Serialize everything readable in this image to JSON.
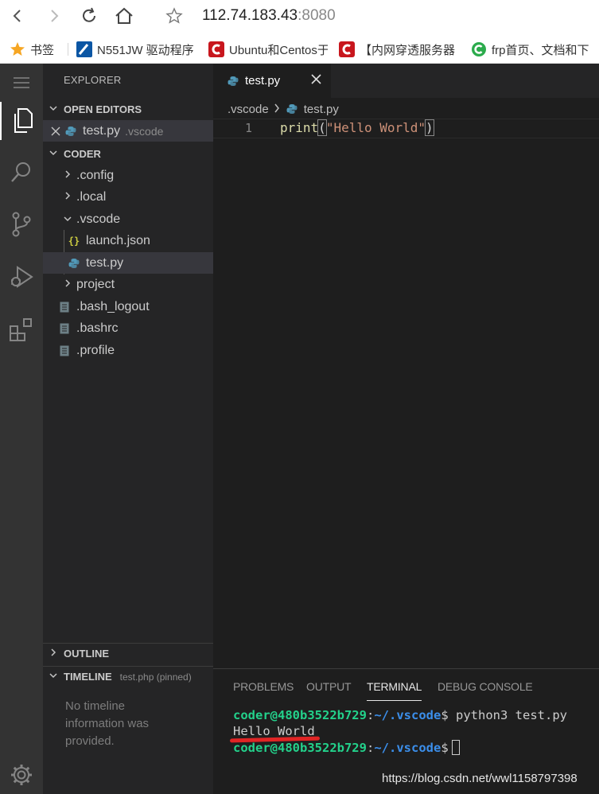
{
  "browser": {
    "url_host": "112.74.183.43",
    "url_port": ":8080"
  },
  "bookmarks": [
    {
      "label": "书签"
    },
    {
      "label": "N551JW 驱动程序"
    },
    {
      "label": "Ubuntu和Centos于"
    },
    {
      "label": "【内网穿透服务器"
    },
    {
      "label": "frp首页、文档和下"
    }
  ],
  "sidebar": {
    "title": "EXPLORER",
    "open_editors_label": "OPEN EDITORS",
    "open_editor": {
      "name": "test.py",
      "dir": ".vscode"
    },
    "workspace_label": "CODER",
    "tree": [
      {
        "label": ".config"
      },
      {
        "label": ".local"
      },
      {
        "label": ".vscode"
      },
      {
        "label": "launch.json"
      },
      {
        "label": "test.py"
      },
      {
        "label": "project"
      },
      {
        "label": ".bash_logout"
      },
      {
        "label": ".bashrc"
      },
      {
        "label": ".profile"
      }
    ],
    "outline_label": "OUTLINE",
    "timeline_label": "TIMELINE",
    "timeline_file": "test.php (pinned)",
    "timeline_empty": "No timeline information was provided."
  },
  "editor": {
    "tab_label": "test.py",
    "breadcrumb": {
      "folder": ".vscode",
      "file": "test.py"
    },
    "line_number": "1",
    "code": {
      "fn": "print",
      "open": "(",
      "str": "\"Hello World\"",
      "close": ")"
    }
  },
  "panel": {
    "tabs": [
      "PROBLEMS",
      "OUTPUT",
      "TERMINAL",
      "DEBUG CONSOLE"
    ],
    "active_tab": "TERMINAL",
    "prompt_user": "coder@480b3522b729",
    "prompt_sep": ":",
    "prompt_path": "~/.vscode",
    "prompt_dollar": "$",
    "command": " python3 test.py",
    "output": "Hello World"
  },
  "watermark": "https://blog.csdn.net/wwl1158797398",
  "colors": {
    "activity_bar": "#333333",
    "sidebar": "#252526",
    "editor": "#1e1e1e",
    "terminal_user": "#23d18b",
    "terminal_path": "#3b8eea",
    "annotation_underline": "#e02525"
  }
}
